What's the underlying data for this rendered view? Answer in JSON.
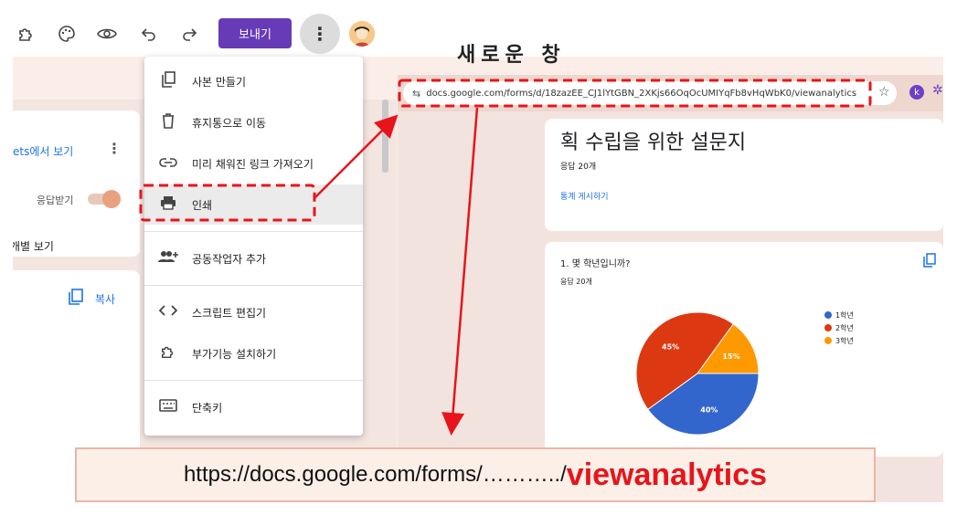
{
  "toolbar": {
    "icons": [
      "puzzle-icon",
      "palette-icon",
      "eye-icon",
      "undo-icon",
      "redo-icon"
    ],
    "send_label": "보내기",
    "more_label": "⋮"
  },
  "left": {
    "sheets_link": "ets에서 보기",
    "accept_label": "응답받기",
    "individual_label": "개별 보기",
    "copy_label": "복사"
  },
  "menu": {
    "items": [
      {
        "label": "사본 만들기",
        "icon": "copy-icon"
      },
      {
        "label": "휴지통으로 이동",
        "icon": "trash-icon"
      },
      {
        "label": "미리 채워진 링크 가져오기",
        "icon": "link-icon"
      },
      {
        "label": "인쇄",
        "icon": "printer-icon"
      },
      {
        "label": "공동작업자 추가",
        "icon": "add-people-icon"
      },
      {
        "label": "스크립트 편집기",
        "icon": "code-icon"
      },
      {
        "label": "부가기능 설치하기",
        "icon": "puzzle-icon"
      },
      {
        "label": "단축키",
        "icon": "keyboard-icon"
      }
    ]
  },
  "new_window_title": "새로운 창",
  "browser": {
    "url": "docs.google.com/forms/d/18zazEE_CJ1lYtGBN_2XKjs66OqOcUMIYqFb8vHqWbK0/viewanalytics"
  },
  "summary": {
    "title": "획 수립을 위한 설문지",
    "responses": "응답 20개",
    "publish_link": "통계 게시하기"
  },
  "question": {
    "title": "1. 몇 학년입니까?",
    "responses": "응답 20개"
  },
  "chart_data": {
    "type": "pie",
    "categories": [
      "1학년",
      "2학년",
      "3학년"
    ],
    "values": [
      40,
      45,
      15
    ],
    "labels": [
      "40%",
      "45%",
      "15%"
    ],
    "colors": [
      "#3366cc",
      "#dc3912",
      "#ff9900"
    ],
    "legend": "right"
  },
  "banner": {
    "prefix": "https://docs.google.com/forms/………../",
    "suffix": "viewanalytics"
  },
  "annotation_color": "#e8141b"
}
